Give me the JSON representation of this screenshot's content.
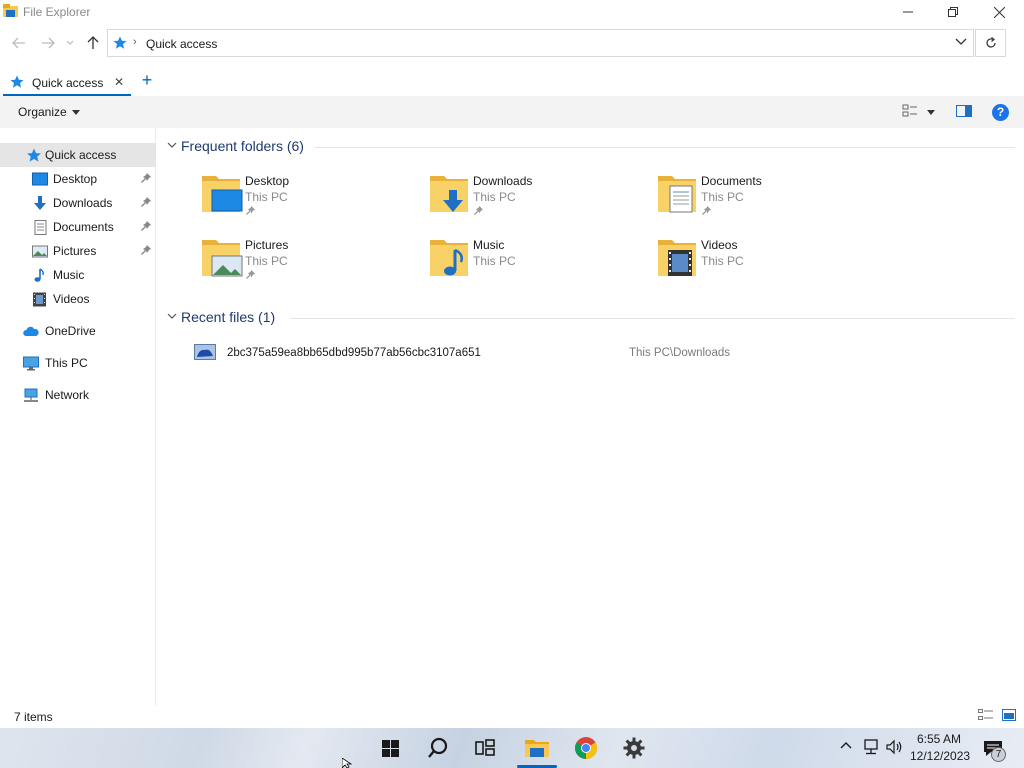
{
  "window": {
    "title": "File Explorer",
    "minimize_icon": "minimize-icon",
    "maximize_icon": "restore-icon",
    "close_icon": "close-icon"
  },
  "address": {
    "crumb": "Quick access",
    "crumb_icon": "star-icon"
  },
  "tabs": [
    {
      "label": "Quick access",
      "icon": "star-icon",
      "close": "✕"
    }
  ],
  "newtab_label": "+",
  "command_bar": {
    "organize_label": "Organize",
    "help_label": "?"
  },
  "sidebar": {
    "items": [
      {
        "label": "Quick access",
        "icon": "star-icon",
        "pinned": false,
        "selected": true
      },
      {
        "label": "Desktop",
        "icon": "desktop-icon",
        "pinned": true
      },
      {
        "label": "Downloads",
        "icon": "download-arrow-icon",
        "pinned": true
      },
      {
        "label": "Documents",
        "icon": "document-icon",
        "pinned": true
      },
      {
        "label": "Pictures",
        "icon": "picture-icon",
        "pinned": true
      },
      {
        "label": "Music",
        "icon": "music-note-icon",
        "pinned": false
      },
      {
        "label": "Videos",
        "icon": "film-icon",
        "pinned": false
      },
      {
        "label": "OneDrive",
        "icon": "cloud-icon",
        "pinned": false
      },
      {
        "label": "This PC",
        "icon": "monitor-icon",
        "pinned": false
      },
      {
        "label": "Network",
        "icon": "network-icon",
        "pinned": false
      }
    ]
  },
  "frequent": {
    "title": "Frequent folders (6)",
    "folders": [
      {
        "name": "Desktop",
        "location": "This PC",
        "pinned": true,
        "overlay": "desktop"
      },
      {
        "name": "Downloads",
        "location": "This PC",
        "pinned": true,
        "overlay": "download"
      },
      {
        "name": "Documents",
        "location": "This PC",
        "pinned": true,
        "overlay": "document"
      },
      {
        "name": "Pictures",
        "location": "This PC",
        "pinned": true,
        "overlay": "picture"
      },
      {
        "name": "Music",
        "location": "This PC",
        "pinned": false,
        "overlay": "music"
      },
      {
        "name": "Videos",
        "location": "This PC",
        "pinned": false,
        "overlay": "video"
      }
    ]
  },
  "recent": {
    "title": "Recent files (1)",
    "files": [
      {
        "name": "2bc375a59ea8bb65dbd995b77ab56cbc3107a651",
        "location": "This PC\\Downloads",
        "icon": "image-file-icon"
      }
    ]
  },
  "status": {
    "count": "7 items"
  },
  "taskbar": {
    "time": "6:55 AM",
    "date": "12/12/2023",
    "notification_count": "7",
    "apps": [
      "windows-start-icon",
      "search-icon",
      "task-view-icon",
      "file-explorer-icon",
      "chrome-icon",
      "settings-gear-icon"
    ]
  },
  "colors": {
    "accent": "#0067c0",
    "folder_yellow": "#f8c850",
    "header_blue": "#1e3a6e"
  }
}
